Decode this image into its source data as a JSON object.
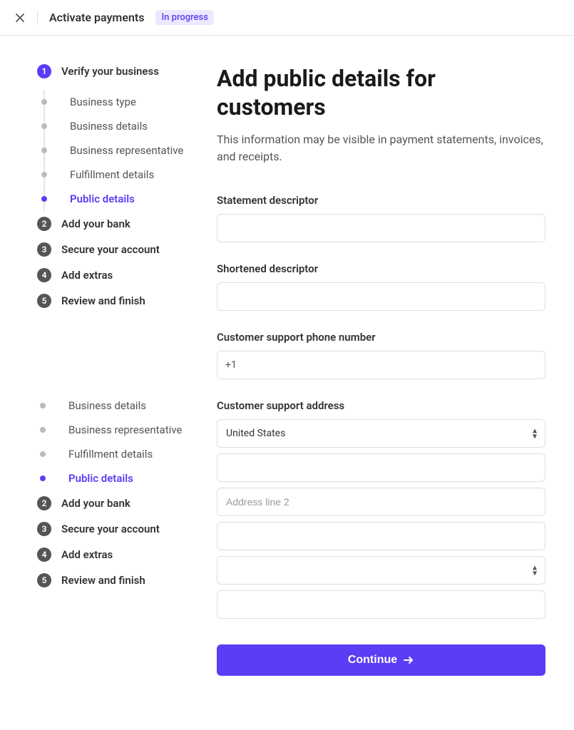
{
  "header": {
    "title": "Activate payments",
    "status": "In progress"
  },
  "sidebar": {
    "steps": [
      {
        "num": "1",
        "label": "Verify your business",
        "state": "active"
      },
      {
        "num": "2",
        "label": "Add your bank",
        "state": "pending"
      },
      {
        "num": "3",
        "label": "Secure your account",
        "state": "pending"
      },
      {
        "num": "4",
        "label": "Add extras",
        "state": "pending"
      },
      {
        "num": "5",
        "label": "Review and finish",
        "state": "pending"
      }
    ],
    "substeps": [
      {
        "label": "Business type",
        "current": false
      },
      {
        "label": "Business details",
        "current": false
      },
      {
        "label": "Business representative",
        "current": false
      },
      {
        "label": "Fulfillment details",
        "current": false
      },
      {
        "label": "Public details",
        "current": true
      }
    ]
  },
  "main": {
    "heading": "Add public details for customers",
    "intro": "This information may be visible in payment statements, invoices, and receipts.",
    "fields": {
      "statement_descriptor": {
        "label": "Statement descriptor",
        "value": ""
      },
      "shortened_descriptor": {
        "label": "Shortened descriptor",
        "value": ""
      },
      "support_phone": {
        "label": "Customer support phone number",
        "prefix": "+1",
        "value": ""
      },
      "support_address": {
        "label": "Customer support address",
        "country": "United States",
        "line1": "",
        "line2_placeholder": "Address line 2",
        "city": "",
        "state": "",
        "zip": ""
      }
    },
    "button": "Continue"
  }
}
